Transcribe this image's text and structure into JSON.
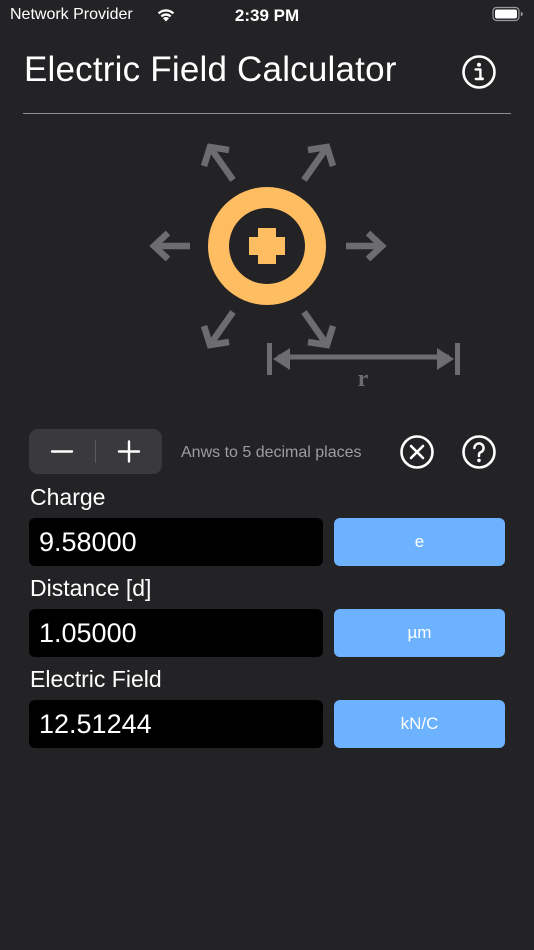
{
  "status_bar": {
    "carrier": "Network Provider",
    "time": "2:39 PM"
  },
  "header": {
    "title": "Electric Field Calculator",
    "info_icon": "info-circle-icon"
  },
  "illustration": {
    "distance_label": "r",
    "charge_color": "#ffbd61",
    "arrow_color": "#6d6d70",
    "charge_sign": "plus"
  },
  "controls": {
    "precision_label": "Anws to 5 decimal places",
    "decrease_icon": "minus-icon",
    "increase_icon": "plus-icon",
    "clear_icon": "clear-circle-icon",
    "help_icon": "help-circle-icon"
  },
  "fields": {
    "charge": {
      "label": "Charge",
      "value": "9.58000",
      "unit": "e"
    },
    "distance": {
      "label": "Distance [d]",
      "value": "1.05000",
      "unit": "µm"
    },
    "field": {
      "label": "Electric Field",
      "value": "12.51244",
      "unit": "kN/C"
    }
  },
  "colors": {
    "background": "#232325",
    "accent_button": "#6cb2ff",
    "input_background": "#000000"
  }
}
